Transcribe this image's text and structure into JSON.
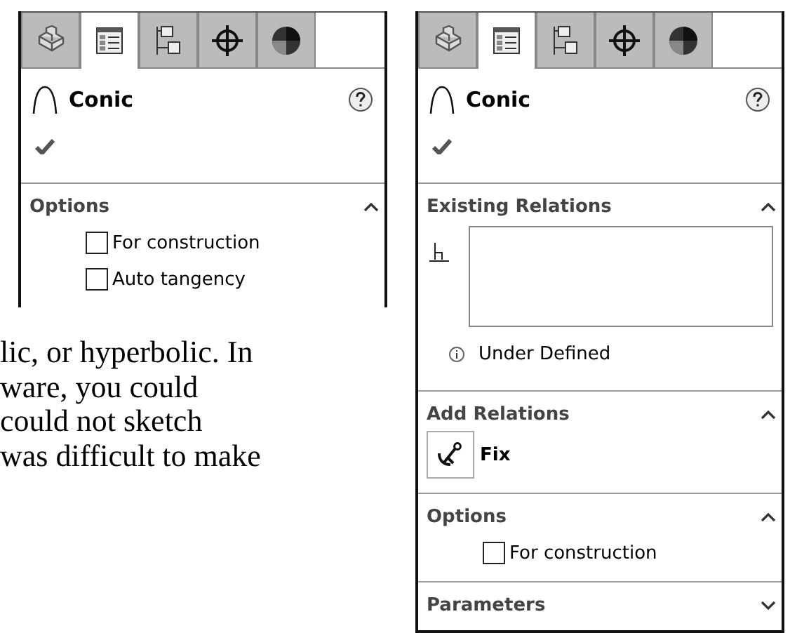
{
  "panels": [
    {
      "tabs": [
        {
          "selected": false
        },
        {
          "selected": true
        },
        {
          "selected": false
        },
        {
          "selected": false
        },
        {
          "selected": false
        }
      ],
      "title": "Conic",
      "sections": [
        {
          "kind": "options",
          "title": "Options",
          "expanded": true,
          "options": [
            {
              "label": "For construction",
              "checked": false
            },
            {
              "label": "Auto tangency",
              "checked": false
            }
          ]
        }
      ]
    },
    {
      "tabs": [
        {
          "selected": false
        },
        {
          "selected": true
        },
        {
          "selected": false
        },
        {
          "selected": false
        },
        {
          "selected": false
        }
      ],
      "title": "Conic",
      "sections": [
        {
          "kind": "relations",
          "title": "Existing Relations",
          "expanded": true,
          "status": "Under Defined"
        },
        {
          "kind": "add_relations",
          "title": "Add Relations",
          "expanded": true,
          "buttons": [
            {
              "label": "Fix"
            }
          ]
        },
        {
          "kind": "options",
          "title": "Options",
          "expanded": true,
          "options": [
            {
              "label": "For construction",
              "checked": false
            }
          ]
        },
        {
          "kind": "options",
          "title": "Parameters",
          "expanded": false
        }
      ]
    }
  ],
  "text_lines": [
    "lic, or hyperbolic. In",
    "ware, you could",
    "could not sketch",
    "was difficult to make"
  ]
}
